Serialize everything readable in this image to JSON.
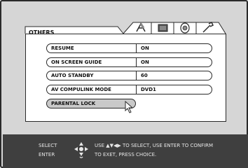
{
  "menu": {
    "title": "OTHERS",
    "tabs": [
      "picture-tab-icon",
      "video-tab-icon",
      "audio-tab-icon",
      "settings-tab-icon"
    ],
    "items": [
      {
        "label": "RESUME",
        "value": "ON"
      },
      {
        "label": "ON SCREEN GUIDE",
        "value": "ON"
      },
      {
        "label": "AUTO STANDBY",
        "value": "60"
      },
      {
        "label": "AV COMPULINK MODE",
        "value": "DVD1"
      },
      {
        "label": "PARENTAL LOCK",
        "value": ""
      }
    ],
    "selected_item": "PARENTAL LOCK"
  },
  "footer": {
    "select_label": "SELECT",
    "enter_label": "ENTER",
    "help_line1": "USE ▲▼◀▶ TO SELECT, USE ENTER TO CONFIRM",
    "help_line2": "TO EXET, PRESS CHOICE."
  },
  "colors": {
    "background": "#d6d6d6",
    "panel": "#ffffff",
    "footer": "#3f3f3f",
    "selected": "#c9c9c9"
  }
}
